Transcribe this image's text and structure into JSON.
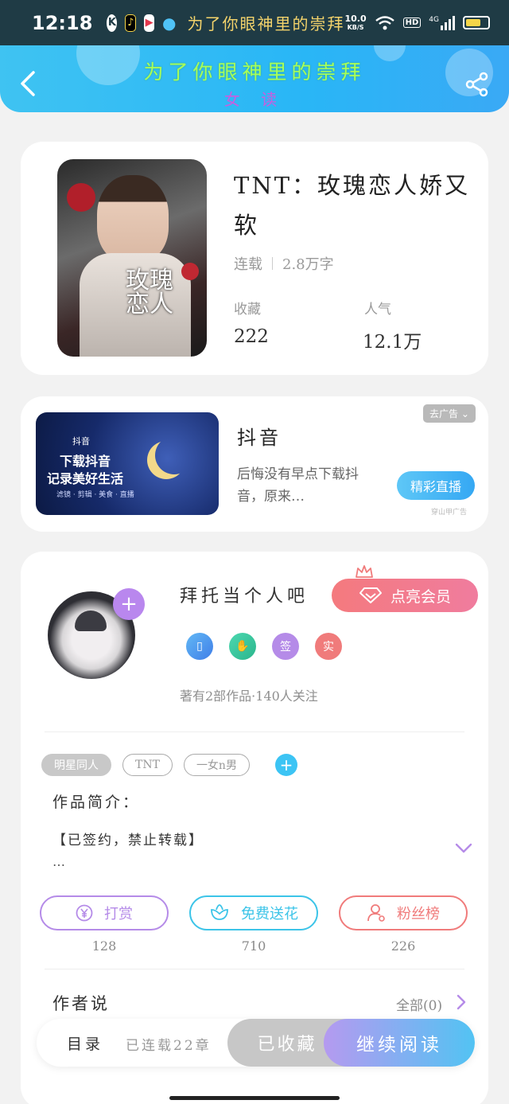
{
  "status_bar": {
    "time": "12:18",
    "marquee": "为了你眼神里的崇拜",
    "speed_value": "10.0",
    "speed_unit": "KB/S",
    "hd": "HD",
    "network": "4G"
  },
  "header": {
    "title": "为了你眼神里的崇拜",
    "subtitle": "女 读"
  },
  "book": {
    "cover_text": "玫瑰恋人",
    "title": "TNT：玫瑰恋人娇又软",
    "status": "连载",
    "word_count": "2.8万字",
    "collect_label": "收藏",
    "collect_value": "222",
    "popularity_label": "人气",
    "popularity_value": "12.1万"
  },
  "ad": {
    "image_brand": "抖音",
    "image_line1": "下载抖音",
    "image_line2": "记录美好生活",
    "image_line3": "滤镜 · 剪辑 · 美食 · 直播",
    "title": "抖音",
    "description": "后悔没有早点下载抖音，原来…",
    "close_label": "去广告 ⌄",
    "cta_label": "精彩直播",
    "source": "穿山甲广告"
  },
  "author": {
    "name": "拜托当个人吧",
    "vip_label": "点亮会员",
    "badges": [
      {
        "icon": "phone-icon",
        "glyph": "▯",
        "color": "#4aa3ee"
      },
      {
        "icon": "handshake-icon",
        "glyph": "✋",
        "color": "#3cc99c"
      },
      {
        "icon": "signed-badge-icon",
        "glyph": "签",
        "color": "#b58be8"
      },
      {
        "icon": "verified-badge-icon",
        "glyph": "实",
        "color": "#f07b7b"
      }
    ],
    "stats": "著有2部作品·140人关注"
  },
  "tags": [
    "明星同人",
    "TNT",
    "一女n男"
  ],
  "intro": {
    "heading": "作品简介：",
    "text": "【已签约，禁止转载】",
    "ellipsis": "…"
  },
  "actions": [
    {
      "label": "打赏",
      "count": "128",
      "color": "#b58be8"
    },
    {
      "label": "免费送花",
      "count": "710",
      "color": "#3cc4e8"
    },
    {
      "label": "粉丝榜",
      "count": "226",
      "color": "#f07b7b"
    }
  ],
  "author_says": {
    "heading": "作者说",
    "all_label": "全部(0)"
  },
  "bottom_bar": {
    "catalog": "目录",
    "progress": "已连载22章",
    "collected": "已收藏",
    "continue": "继续阅读"
  }
}
